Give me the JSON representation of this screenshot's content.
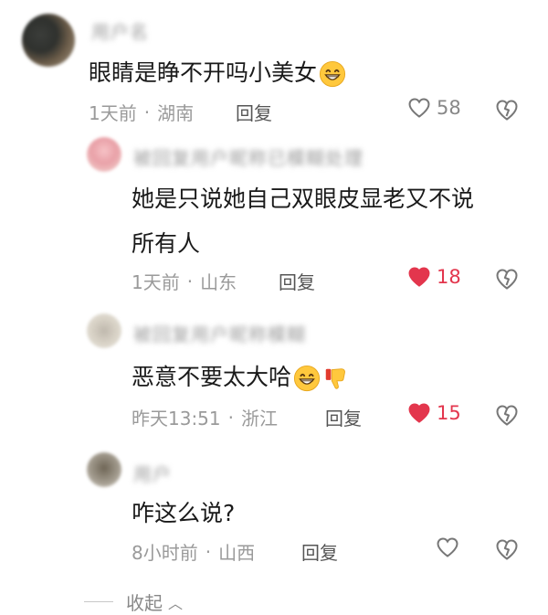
{
  "comment": {
    "username": "用户名",
    "text": "眼睛是睁不开吗小美女",
    "time": "1天前",
    "location": "湖南",
    "reply_label": "回复",
    "likes": "58"
  },
  "replies": [
    {
      "username": "被回复用户昵称已模糊处理",
      "text_line1": "她是只说她自己双眼皮显老又不说",
      "text_line2": "所有人",
      "time": "1天前",
      "location": "山东",
      "reply_label": "回复",
      "likes": "18",
      "liked": true
    },
    {
      "username": "被回复用户昵称模糊",
      "text": "恶意不要太大哈",
      "time": "昨天13:51",
      "location": "浙江",
      "reply_label": "回复",
      "likes": "15",
      "liked": true
    },
    {
      "username": "用户",
      "text": "咋这么说?",
      "time": "8小时前",
      "location": "山西",
      "reply_label": "回复",
      "likes": "",
      "liked": false
    }
  ],
  "collapse_label": "收起",
  "colors": {
    "like_red": "#e3364d",
    "meta_gray": "#9a9a9a",
    "icon_gray": "#7a7a7a"
  },
  "icons": [
    "heart-outline-icon",
    "heart-filled-icon",
    "dislike-icon",
    "grin-emoji-icon",
    "thumbs-down-emoji-icon",
    "chevron-up-icon"
  ]
}
